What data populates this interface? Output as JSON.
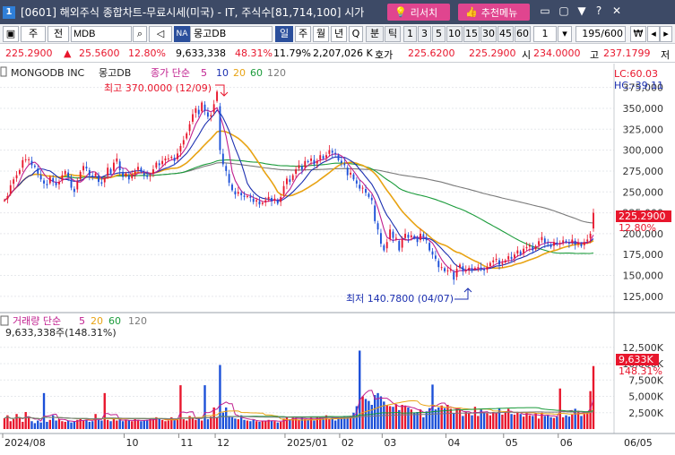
{
  "window": {
    "badge": "1",
    "title": "[0601] 해외주식 종합차트-무료시세(미국) - IT, 주식수[81,714,100] 시가",
    "research_button": "리서치",
    "recommend_button": "추천메뉴",
    "controls": [
      "▭",
      "▢",
      "▼",
      "?",
      "✕"
    ]
  },
  "toolbar": {
    "market_select": "주",
    "type_select": "전",
    "symbol_input": "MDB",
    "exchange_badge": "NA",
    "name_field": "몽고DB",
    "period_tabs": [
      "일",
      "주",
      "월",
      "년",
      "Q",
      "분",
      "틱"
    ],
    "active_tab": "일",
    "interval_buttons": [
      "1",
      "3",
      "5",
      "10",
      "15",
      "30",
      "45",
      "60"
    ],
    "interval_value": "1",
    "count_value": "195",
    "count_max": "/600",
    "won_label": "₩"
  },
  "quote": {
    "price": "225.2900",
    "change_arrow": "▲",
    "change": "25.5600",
    "change_pct": "12.80%",
    "volume": "9,633,338",
    "volume_ratio": "48.31%",
    "turnover_pct": "11.79%",
    "prev_volume": "2,207,026 K",
    "bid_label": "호가",
    "bid": "225.6200",
    "ask": "225.2900",
    "open_label": "시",
    "open": "234.0000",
    "high_label": "고",
    "high": "237.1799",
    "low_label": "저"
  },
  "chart": {
    "title": "MONGODB INC",
    "name": "몽고DB",
    "legend_label": "종가 단순",
    "ma_periods": [
      "5",
      "10",
      "20",
      "60",
      "120"
    ],
    "ma_colors": [
      "#c0208f",
      "#1b2fb0",
      "#e8a313",
      "#1a9b3a",
      "#7a7a7a"
    ],
    "lc": "LC:60.03",
    "hc": "HC:-39.11",
    "high_annotation": "최고 370.0000 (12/09)",
    "low_annotation": "최저 140.7800 (04/07)",
    "price_tag": "225.2900",
    "pct_tag": "12.80%",
    "volume_label": "거래량 단순",
    "volume_ma": [
      "5",
      "20",
      "60",
      "120"
    ],
    "volume_text": "9,633,338주(148.31%)",
    "volume_tag": "9,633K",
    "volume_pct_tag": "148.31%",
    "x_labels": [
      "2024/08",
      "10",
      "11",
      "12",
      "2025/01",
      "02",
      "03",
      "04",
      "05",
      "06",
      "06/05"
    ]
  },
  "chart_data": {
    "type": "line",
    "price_axis": [
      125000,
      150000,
      175000,
      200000,
      225000,
      250000,
      275000,
      300000,
      325000,
      350000,
      375000
    ],
    "price_tick_labels": [
      "125,000",
      "150,000",
      "175,000",
      "200,000",
      "225,000",
      "250,000",
      "275,000",
      "300,000",
      "325,000",
      "350,000",
      "375,000"
    ],
    "volume_axis": [
      2500,
      5000,
      7500,
      10000,
      12500
    ],
    "volume_tick_labels": [
      "2,500K",
      "5,000K",
      "7,500K",
      "10,000K",
      "12,500K"
    ],
    "ylim": [
      112,
      380
    ],
    "vol_ylim": [
      0,
      14800
    ],
    "price_close": [
      240,
      245,
      258,
      265,
      270,
      276,
      288,
      289,
      289,
      282,
      280,
      272,
      265,
      260,
      258,
      268,
      262,
      258,
      262,
      270,
      275,
      268,
      255,
      250,
      262,
      274,
      281,
      278,
      270,
      268,
      272,
      262,
      260,
      266,
      279,
      272,
      285,
      290,
      276,
      268,
      272,
      265,
      270,
      275,
      280,
      274,
      270,
      268,
      270,
      277,
      285,
      282,
      287,
      290,
      290,
      292,
      287,
      296,
      305,
      312,
      320,
      331,
      343,
      350,
      343,
      357,
      347,
      340,
      342,
      355,
      370,
      300,
      283,
      275,
      261,
      252,
      247,
      250,
      246,
      244,
      245,
      243,
      238,
      240,
      235,
      237,
      240,
      244,
      239,
      242,
      236,
      244,
      257,
      266,
      262,
      270,
      277,
      282,
      277,
      287,
      286,
      290,
      283,
      287,
      294,
      290,
      294,
      300,
      297,
      296,
      288,
      285,
      282,
      270,
      273,
      265,
      260,
      254,
      255,
      249,
      244,
      240,
      215,
      205,
      188,
      180,
      190,
      205,
      195,
      195,
      180,
      193,
      200,
      195,
      198,
      195,
      190,
      200,
      197,
      192,
      180,
      175,
      170,
      160,
      160,
      155,
      156,
      157,
      145,
      158,
      163,
      155,
      156,
      159,
      157,
      159,
      160,
      158,
      156,
      160,
      165,
      168,
      170,
      163,
      165,
      168,
      173,
      170,
      175,
      180,
      175,
      182,
      184,
      186,
      180,
      185,
      191,
      196,
      189,
      188,
      184,
      190,
      188,
      189,
      192,
      190,
      188,
      193,
      187,
      189,
      185,
      190,
      193,
      200,
      225
    ],
    "volume": [
      1650,
      2100,
      1200,
      1500,
      2300,
      1700,
      1100,
      2600,
      1800,
      1200,
      900,
      1300,
      1000,
      5500,
      1100,
      1400,
      2100,
      1300,
      1500,
      1200,
      1100,
      1300,
      1000,
      1200,
      1400,
      1600,
      1300,
      1400,
      1100,
      1200,
      2300,
      1400,
      1300,
      5500,
      1400,
      1200,
      1600,
      1300,
      1500,
      1200,
      1400,
      1300,
      1200,
      1500,
      1400,
      1200,
      1300,
      1400,
      1600,
      1500,
      1800,
      1600,
      1400,
      1200,
      1300,
      1800,
      1400,
      1600,
      6700,
      1500,
      1300,
      2000,
      1700,
      1400,
      1600,
      1300,
      6700,
      1500,
      1900,
      3300,
      1800,
      9800,
      2500,
      3300,
      2000,
      1800,
      1600,
      1500,
      2100,
      1400,
      1300,
      1200,
      1400,
      1200,
      1100,
      1300,
      1200,
      1400,
      1300,
      1200,
      1000,
      1100,
      1600,
      1800,
      1500,
      1700,
      1600,
      1400,
      1800,
      1500,
      1400,
      1700,
      1300,
      1900,
      1800,
      1600,
      2100,
      1500,
      1700,
      1300,
      1600,
      1800,
      2000,
      1900,
      2000,
      2500,
      3500,
      12000,
      5000,
      4600,
      4300,
      3700,
      5200,
      5500,
      5000,
      4200,
      3700,
      3500,
      3400,
      3800,
      2900,
      3700,
      3600,
      3300,
      3000,
      2500,
      2600,
      3000,
      1800,
      2700,
      3200,
      6800,
      3000,
      3300,
      3600,
      3200,
      3700,
      3100,
      2400,
      3100,
      3000,
      2000,
      2700,
      2500,
      2100,
      3400,
      2000,
      3000,
      2500,
      2400,
      2100,
      2600,
      2500,
      3200,
      2200,
      2700,
      3100,
      2300,
      2200,
      2500,
      2300,
      1900,
      2600,
      2100,
      2000,
      2400,
      1600,
      2500,
      2000,
      2100,
      1800,
      1700,
      1900,
      6200,
      1800,
      2100,
      1900,
      2200,
      3100,
      2800,
      2000,
      2300,
      2600,
      5800,
      9633
    ]
  }
}
